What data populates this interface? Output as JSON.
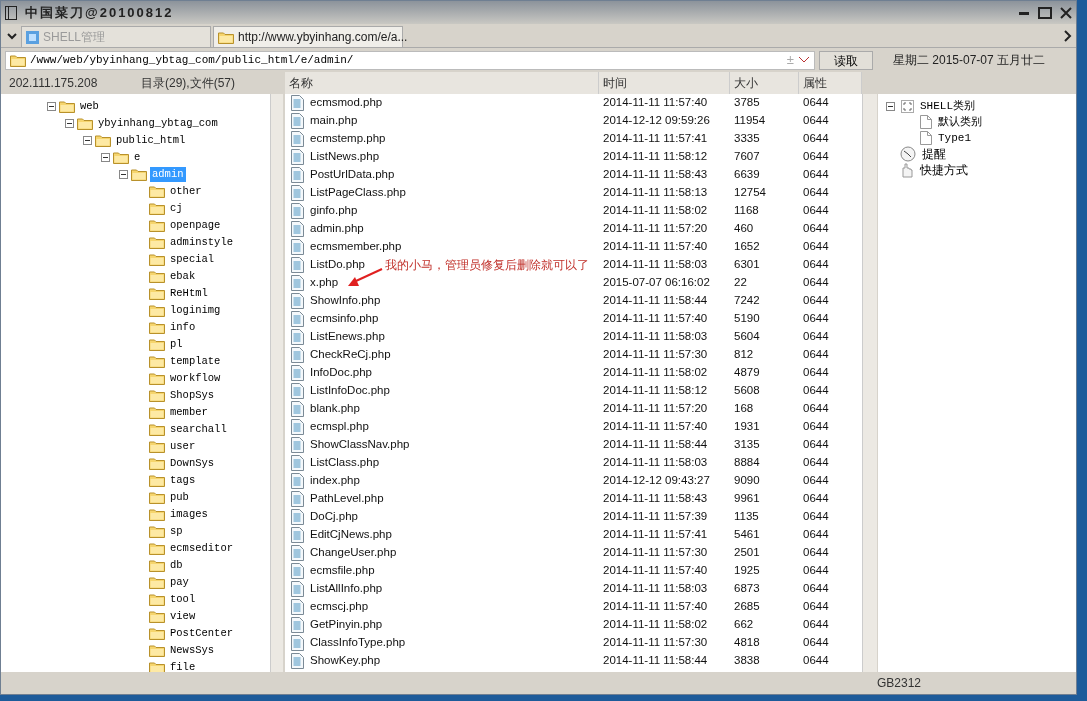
{
  "window": {
    "title": "中国菜刀@20100812"
  },
  "tabs": [
    {
      "label": "SHELL管理",
      "selected": false,
      "kind": "shell"
    },
    {
      "label": "http://www.ybyinhang.com/e/a...",
      "selected": true,
      "kind": "folder"
    }
  ],
  "address": {
    "value": "/www/web/ybyinhang_ybtag_com/public_html/e/admin/",
    "plus": "±",
    "button": "读取",
    "date": "星期二 2015-07-07 五月廿二"
  },
  "info": {
    "host": "202.111.175.208",
    "counts": "目录(29),文件(57)"
  },
  "tree": [
    {
      "label": "web",
      "expanded": true,
      "selected": false,
      "children": [
        {
          "label": "ybyinhang_ybtag_com",
          "expanded": true,
          "selected": false,
          "children": [
            {
              "label": "public_html",
              "expanded": true,
              "selected": false,
              "children": [
                {
                  "label": "e",
                  "expanded": true,
                  "selected": false,
                  "children": [
                    {
                      "label": "admin",
                      "expanded": true,
                      "selected": true,
                      "children": [
                        {
                          "label": "other"
                        },
                        {
                          "label": "cj"
                        },
                        {
                          "label": "openpage"
                        },
                        {
                          "label": "adminstyle"
                        },
                        {
                          "label": "special"
                        },
                        {
                          "label": "ebak"
                        },
                        {
                          "label": "ReHtml"
                        },
                        {
                          "label": "loginimg"
                        },
                        {
                          "label": "info"
                        },
                        {
                          "label": "pl"
                        },
                        {
                          "label": "template"
                        },
                        {
                          "label": "workflow"
                        },
                        {
                          "label": "ShopSys"
                        },
                        {
                          "label": "member"
                        },
                        {
                          "label": "searchall"
                        },
                        {
                          "label": "user"
                        },
                        {
                          "label": "DownSys"
                        },
                        {
                          "label": "tags"
                        },
                        {
                          "label": "pub"
                        },
                        {
                          "label": "images"
                        },
                        {
                          "label": "sp"
                        },
                        {
                          "label": "ecmseditor"
                        },
                        {
                          "label": "db"
                        },
                        {
                          "label": "pay"
                        },
                        {
                          "label": "tool"
                        },
                        {
                          "label": "view"
                        },
                        {
                          "label": "PostCenter"
                        },
                        {
                          "label": "NewsSys"
                        },
                        {
                          "label": "file"
                        }
                      ]
                    }
                  ]
                }
              ]
            }
          ]
        }
      ]
    }
  ],
  "table": {
    "columns": [
      "名称",
      "时间",
      "大小",
      "属性"
    ],
    "rows": [
      [
        "ecmsmod.php",
        "2014-11-11 11:57:40",
        "3785",
        "0644"
      ],
      [
        "main.php",
        "2014-12-12 09:59:26",
        "11954",
        "0644"
      ],
      [
        "ecmstemp.php",
        "2014-11-11 11:57:41",
        "3335",
        "0644"
      ],
      [
        "ListNews.php",
        "2014-11-11 11:58:12",
        "7607",
        "0644"
      ],
      [
        "PostUrlData.php",
        "2014-11-11 11:58:43",
        "6639",
        "0644"
      ],
      [
        "ListPageClass.php",
        "2014-11-11 11:58:13",
        "12754",
        "0644"
      ],
      [
        "ginfo.php",
        "2014-11-11 11:58:02",
        "1168",
        "0644"
      ],
      [
        "admin.php",
        "2014-11-11 11:57:20",
        "460",
        "0644"
      ],
      [
        "ecmsmember.php",
        "2014-11-11 11:57:40",
        "1652",
        "0644"
      ],
      [
        "ListDo.php",
        "2014-11-11 11:58:03",
        "6301",
        "0644"
      ],
      [
        "x.php",
        "2015-07-07 06:16:02",
        "22",
        "0644"
      ],
      [
        "ShowInfo.php",
        "2014-11-11 11:58:44",
        "7242",
        "0644"
      ],
      [
        "ecmsinfo.php",
        "2014-11-11 11:57:40",
        "5190",
        "0644"
      ],
      [
        "ListEnews.php",
        "2014-11-11 11:58:03",
        "5604",
        "0644"
      ],
      [
        "CheckReCj.php",
        "2014-11-11 11:57:30",
        "812",
        "0644"
      ],
      [
        "InfoDoc.php",
        "2014-11-11 11:58:02",
        "4879",
        "0644"
      ],
      [
        "ListInfoDoc.php",
        "2014-11-11 11:58:12",
        "5608",
        "0644"
      ],
      [
        "blank.php",
        "2014-11-11 11:57:20",
        "168",
        "0644"
      ],
      [
        "ecmspl.php",
        "2014-11-11 11:57:40",
        "1931",
        "0644"
      ],
      [
        "ShowClassNav.php",
        "2014-11-11 11:58:44",
        "3135",
        "0644"
      ],
      [
        "ListClass.php",
        "2014-11-11 11:58:03",
        "8884",
        "0644"
      ],
      [
        "index.php",
        "2014-12-12 09:43:27",
        "9090",
        "0644"
      ],
      [
        "PathLevel.php",
        "2014-11-11 11:58:43",
        "9961",
        "0644"
      ],
      [
        "DoCj.php",
        "2014-11-11 11:57:39",
        "1135",
        "0644"
      ],
      [
        "EditCjNews.php",
        "2014-11-11 11:57:41",
        "5461",
        "0644"
      ],
      [
        "ChangeUser.php",
        "2014-11-11 11:57:30",
        "2501",
        "0644"
      ],
      [
        "ecmsfile.php",
        "2014-11-11 11:57:40",
        "1925",
        "0644"
      ],
      [
        "ListAllInfo.php",
        "2014-11-11 11:58:03",
        "6873",
        "0644"
      ],
      [
        "ecmscj.php",
        "2014-11-11 11:57:40",
        "2685",
        "0644"
      ],
      [
        "GetPinyin.php",
        "2014-11-11 11:58:02",
        "662",
        "0644"
      ],
      [
        "ClassInfoType.php",
        "2014-11-11 11:57:30",
        "4818",
        "0644"
      ],
      [
        "ShowKey.php",
        "2014-11-11 11:58:44",
        "3838",
        "0644"
      ]
    ]
  },
  "annotation": {
    "text": "我的小马，管理员修复后删除就可以了"
  },
  "side_tree": [
    {
      "label": "SHELL类别",
      "kind": "category",
      "expanded": true,
      "children": [
        {
          "label": "默认类别"
        },
        {
          "label": "Type1"
        }
      ]
    },
    {
      "label": "提醒",
      "kind": "reminder"
    },
    {
      "label": "快捷方式",
      "kind": "shortcut"
    }
  ],
  "status_bar": {
    "encoding": "GB2312"
  }
}
